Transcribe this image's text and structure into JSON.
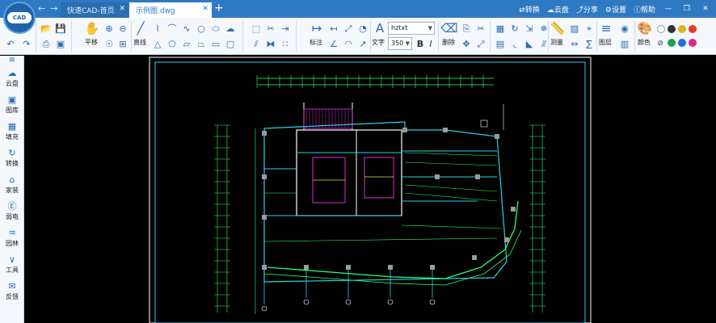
{
  "app": {
    "logo_text": "CAD"
  },
  "tabs": [
    {
      "label": "快速CAD-首页"
    },
    {
      "label": "示例图.dwg"
    }
  ],
  "titlebar": {
    "convert": "转换",
    "cloud": "云盘",
    "share": "分享",
    "settings": "设置",
    "help": "帮助"
  },
  "toolbar": {
    "pan_label": "平移",
    "line_label": "直线",
    "annotate_label": "标注",
    "text_label": "文字",
    "font_value": "hztxt",
    "size_value": "350",
    "delete_label": "删除",
    "measure_label": "测量",
    "layer_label": "图层",
    "color_label": "颜色",
    "colors": [
      "#ffffff",
      "#333333",
      "#e0b21c",
      "#e23b2a",
      "#1fa34a",
      "#1f6fd6",
      "#d92c8a"
    ]
  },
  "sidebar": {
    "items": [
      {
        "label": "云盘",
        "icon": "cloud-icon"
      },
      {
        "label": "图库",
        "icon": "gallery-icon"
      },
      {
        "label": "填充",
        "icon": "fill-icon"
      },
      {
        "label": "转换",
        "icon": "convert-icon"
      },
      {
        "label": "家装",
        "icon": "home-icon"
      },
      {
        "label": "弱电",
        "icon": "electric-icon"
      },
      {
        "label": "园林",
        "icon": "garden-icon"
      },
      {
        "label": "工具",
        "icon": "tools-icon"
      },
      {
        "label": "反馈",
        "icon": "feedback-icon"
      }
    ]
  }
}
